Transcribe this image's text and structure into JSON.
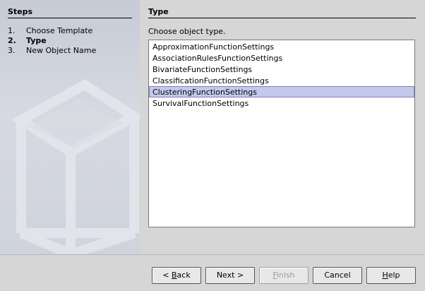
{
  "steps": {
    "title": "Steps",
    "items": [
      {
        "num": "1.",
        "label": "Choose Template",
        "current": false
      },
      {
        "num": "2.",
        "label": "Type",
        "current": true
      },
      {
        "num": "3.",
        "label": "New Object Name",
        "current": false
      }
    ]
  },
  "panel": {
    "title": "Type",
    "prompt": "Choose object type.",
    "options": [
      "ApproximationFunctionSettings",
      "AssociationRulesFunctionSettings",
      "BivariateFunctionSettings",
      "ClassificationFunctionSettings",
      "ClusteringFunctionSettings",
      "SurvivalFunctionSettings"
    ],
    "selected_option": "ClusteringFunctionSettings"
  },
  "buttons": {
    "back": {
      "pre": "< ",
      "mnemonic": "B",
      "post": "ack"
    },
    "next": "Next >",
    "finish": {
      "pre": "",
      "mnemonic": "F",
      "post": "inish",
      "enabled": false
    },
    "cancel": "Cancel",
    "help": {
      "pre": "",
      "mnemonic": "H",
      "post": "elp"
    }
  },
  "colors": {
    "selection_bg": "#c4c9ec",
    "sidebar_bg": "#cfd3dc",
    "dialog_bg": "#d6d6d6"
  }
}
